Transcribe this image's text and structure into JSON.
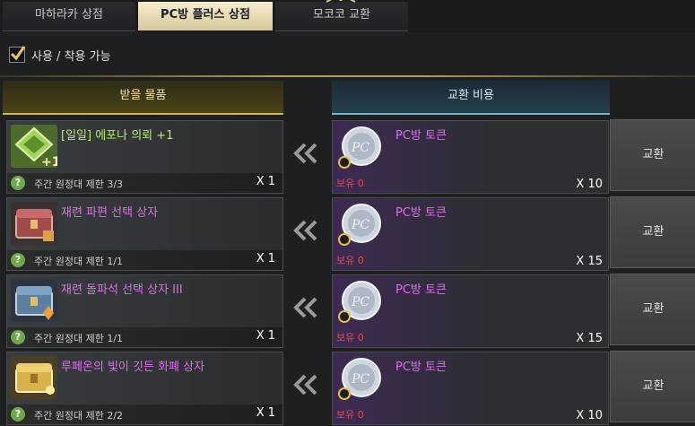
{
  "tabs": [
    {
      "label": "마하라카 상점",
      "active": false
    },
    {
      "label": "PC방 플러스 상점",
      "active": true
    },
    {
      "label": "모코코 교환",
      "active": false
    }
  ],
  "filter": {
    "label": "사용 / 착용 가능",
    "checked": true
  },
  "columns": {
    "receive": "받을 물품",
    "cost": "교환 비용"
  },
  "rows": [
    {
      "item_name": "[일일] 에포나 의뢰 +1",
      "item_icon": "epona-quest-icon",
      "limit": "주간 원정대 제한 3/3",
      "item_qty": "X 1",
      "cost_name": "PC방 토큰",
      "cost_icon": "pc-token-icon",
      "owned": "보유 0",
      "cost_qty": "X 10",
      "button": "교환"
    },
    {
      "item_name": "재련 파편 선택 상자",
      "item_icon": "red-chest-icon",
      "limit": "주간 원정대 제한 1/1",
      "item_qty": "X 1",
      "cost_name": "PC방 토큰",
      "cost_icon": "pc-token-icon",
      "owned": "보유 0",
      "cost_qty": "X 15",
      "button": "교환"
    },
    {
      "item_name": "재련 돌파석 선택 상자 III",
      "item_icon": "blue-chest-icon",
      "limit": "주간 원정대 제한 1/1",
      "item_qty": "X 1",
      "cost_name": "PC방 토큰",
      "cost_icon": "pc-token-icon",
      "owned": "보유 0",
      "cost_qty": "X 15",
      "button": "교환"
    },
    {
      "item_name": "루페온의 빛이 깃든 화폐 상자",
      "item_icon": "gold-chest-icon",
      "limit": "주간 원정대 제한 2/2",
      "item_qty": "X 1",
      "cost_name": "PC방 토큰",
      "cost_icon": "pc-token-icon",
      "owned": "보유 0",
      "cost_qty": "X 10",
      "button": "교환"
    }
  ],
  "colors": {
    "item_name": "#e06cf0",
    "item_name_quest": "#b8f060",
    "owned_warning": "#e34d4d",
    "active_tab": "#f6edcf"
  }
}
